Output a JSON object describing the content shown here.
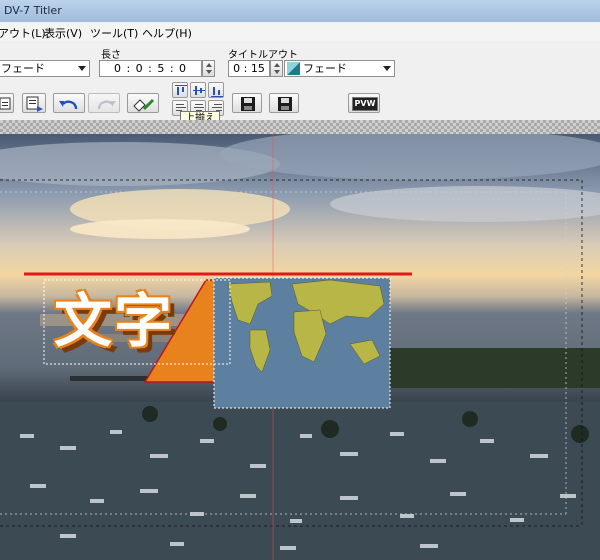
{
  "window": {
    "title": "DV-7 Titler"
  },
  "menu": {
    "items": [
      "アウト(L)",
      "表示(V)",
      "ツール(T)",
      "ヘルプ(H)"
    ]
  },
  "fields": {
    "left_dropdown_value": "フェード",
    "length_label": "長さ",
    "length_value": "0 : 0 : 5 : 0",
    "titleout_label": "タイトルアウト",
    "titleout_value": "0 : 15",
    "titleout_effect": "フェード"
  },
  "toolbar": {
    "pvw_label": "PVW"
  },
  "tooltip": {
    "text": "上揃え"
  },
  "canvas": {
    "title_text": "文字"
  },
  "colors": {
    "accent_orange": "#e8821c",
    "title_line_red": "#e0191b",
    "map_sea": "#5d7fa0",
    "map_land": "#b7b646"
  }
}
